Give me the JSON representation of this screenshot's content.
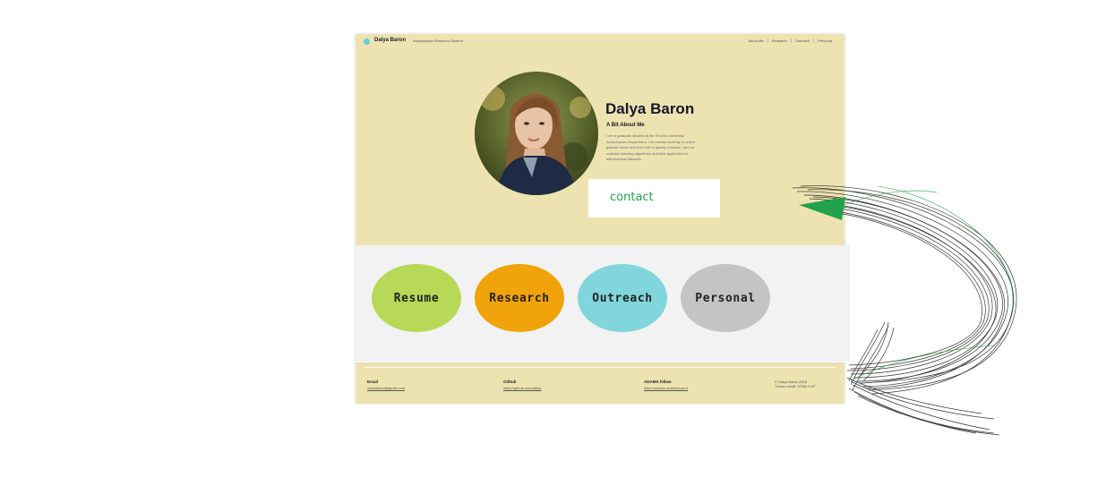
{
  "site": {
    "brand": "Dalya Baron",
    "tagline": "Astrophysics Research Student"
  },
  "nav": {
    "items": [
      "About Me",
      "Research",
      "Outreach",
      "Personal"
    ]
  },
  "hero": {
    "name": "Dalya Baron",
    "about_heading": "A Bit About Me",
    "about_text": "I am a graduate student at the Tel Aviv University Astrophysics Department. I am mostly working on active galactic nuclei and their role in galaxy evolution, and on machine learning algorithms and their application to astronomical datasets."
  },
  "contact": {
    "label": "contact"
  },
  "tiles": [
    {
      "label": "Resume",
      "color": "#b7d957"
    },
    {
      "label": "Research",
      "color": "#f0a30a"
    },
    {
      "label": "Outreach",
      "color": "#80d6dc"
    },
    {
      "label": "Personal",
      "color": "#c4c4c4"
    }
  ],
  "footer": {
    "email_label": "Email",
    "email_value": "dalyabaron@gmail.com",
    "github_label": "Github",
    "github_value": "https://github.com/dalya",
    "adams_label": "ADAMS fellow",
    "adams_value": "https://adams.academy.ac.il",
    "note_line1": "© Dalya Baron 2018",
    "note_line2": "Theme credit: HTML5 UP"
  },
  "colors": {
    "hero_bg": "#ede3b0",
    "band_bg": "#f2f2f2",
    "contact_text": "#22a24a",
    "arrow_fill": "#22a24a",
    "scribble": "#111111",
    "logo_dot": "#5fd0d8"
  }
}
